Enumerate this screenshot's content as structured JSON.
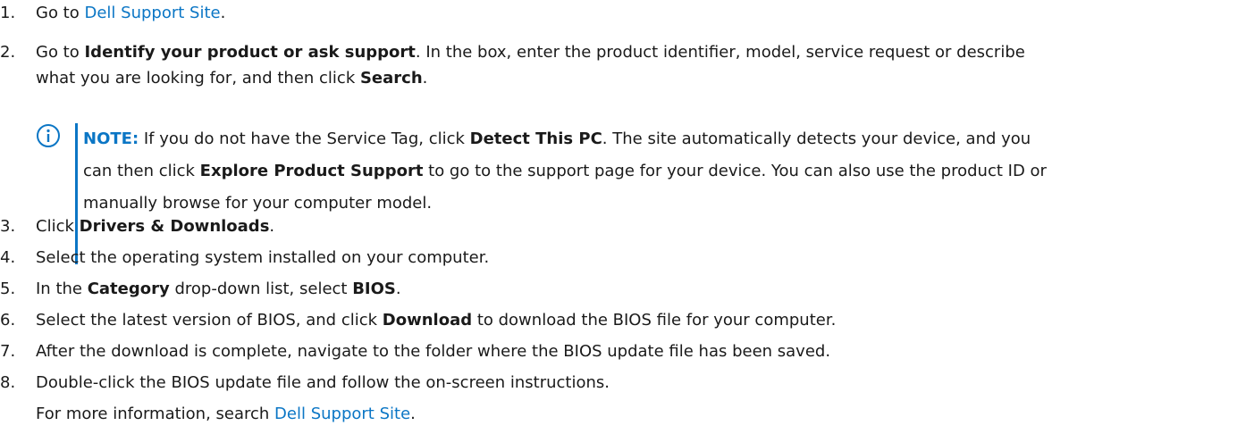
{
  "steps": [
    {
      "num": "1.",
      "text_before": "Go to ",
      "link": "Dell Support Site",
      "text_after": "."
    },
    {
      "num": "2.",
      "pre": "Go to ",
      "b1": "Identify your product or ask support",
      "mid": ". In the box, enter the product identifier, model, service request or describe",
      "line2_pre": "what you are looking for, and then click ",
      "b2": "Search",
      "post": "."
    },
    {
      "num": "3.",
      "pre": "Click ",
      "b1": "Drivers & Downloads",
      "post": "."
    },
    {
      "num": "4.",
      "text": "Select the operating system installed on your computer."
    },
    {
      "num": "5.",
      "pre": "In the ",
      "b1": "Category",
      "mid": " drop-down list, select ",
      "b2": "BIOS",
      "post": "."
    },
    {
      "num": "6.",
      "pre": "Select the latest version of BIOS, and click ",
      "b1": "Download",
      "post": " to download the BIOS file for your computer."
    },
    {
      "num": "7.",
      "text": "After the download is complete, navigate to the folder where the BIOS update file has been saved."
    },
    {
      "num": "8.",
      "text": "Double-click the BIOS update file and follow the on-screen instructions."
    }
  ],
  "note": {
    "label": "NOTE:",
    "l1_pre": " If you do not have the Service Tag, click ",
    "l1_b": "Detect This PC",
    "l1_post": ". The site automatically detects your device, and you",
    "l2_pre": "can then click ",
    "l2_b": "Explore Product Support",
    "l2_post": " to go to the support page for your device. You can also use the product ID or",
    "l3": "manually browse for your computer model."
  },
  "followup": {
    "pre": "For more information, search ",
    "link": "Dell Support Site",
    "post": "."
  },
  "colors": {
    "link": "#0b76c5",
    "text": "#1a1a1a"
  },
  "icons": {
    "note": "info-circle-icon"
  }
}
